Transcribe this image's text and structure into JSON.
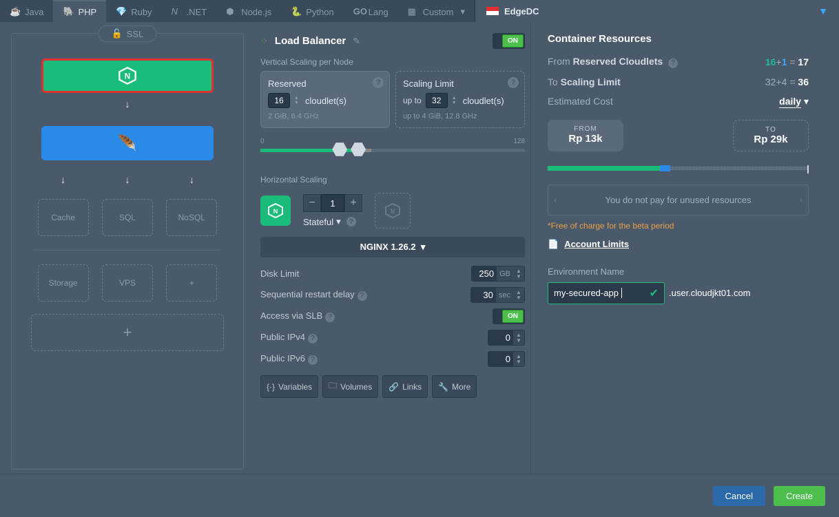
{
  "tabs": {
    "java": "Java",
    "php": "PHP",
    "ruby": "Ruby",
    "dotnet": ".NET",
    "nodejs": "Node.js",
    "python": "Python",
    "go": "Lang",
    "custom": "Custom"
  },
  "region": {
    "name": "EdgeDC"
  },
  "ssl_label": "SSL",
  "topology": {
    "cache": "Cache",
    "sql": "SQL",
    "nosql": "NoSQL",
    "storage": "Storage",
    "vps": "VPS"
  },
  "lb": {
    "title": "Load Balancer",
    "on": "ON",
    "section_label": "Vertical Scaling per Node",
    "reserved": {
      "title": "Reserved",
      "value": "16",
      "unit": "cloudlet(s)",
      "sub": "2 GiB, 6.4 GHz"
    },
    "limit": {
      "title": "Scaling Limit",
      "prefix": "up to",
      "value": "32",
      "unit": "cloudlet(s)",
      "sub": "up to 4 GiB, 12.8 GHz"
    },
    "range": {
      "min": "0",
      "max": "128"
    },
    "hscaling": "Horizontal Scaling",
    "count": "1",
    "stateful": "Stateful",
    "version": "NGINX 1.26.2",
    "disk_label": "Disk Limit",
    "disk_val": "250",
    "disk_unit": "GB",
    "restart_label": "Sequential restart delay",
    "restart_val": "30",
    "restart_unit": "sec",
    "slb_label": "Access via SLB",
    "slb_on": "ON",
    "ipv4_label": "Public IPv4",
    "ipv4_val": "0",
    "ipv6_label": "Public IPv6",
    "ipv6_val": "0",
    "btns": {
      "vars": "Variables",
      "vols": "Volumes",
      "links": "Links",
      "more": "More"
    }
  },
  "res": {
    "title": "Container Resources",
    "from_lbl": "From ",
    "from_b": "Reserved Cloudlets",
    "from_a": "16",
    "from_plus": "+",
    "from_b2": "1",
    "from_eq": " = ",
    "from_tot": "17",
    "to_lbl": "To ",
    "to_b": "Scaling Limit",
    "to_a": "32",
    "to_plus": "+",
    "to_b2": "4",
    "to_eq": " = ",
    "to_tot": "36",
    "est": "Estimated Cost",
    "period": "daily",
    "from_head": "FROM",
    "from_val": "Rp 13k",
    "to_head": "TO",
    "to_val": "Rp 29k",
    "info": "You do not pay for unused resources",
    "note": "*Free of charge for the beta period",
    "limits": "Account Limits",
    "env_head": "Environment Name",
    "env_val": "my-secured-app",
    "domain": ".user.cloudjkt01.com"
  },
  "footer": {
    "cancel": "Cancel",
    "create": "Create"
  }
}
